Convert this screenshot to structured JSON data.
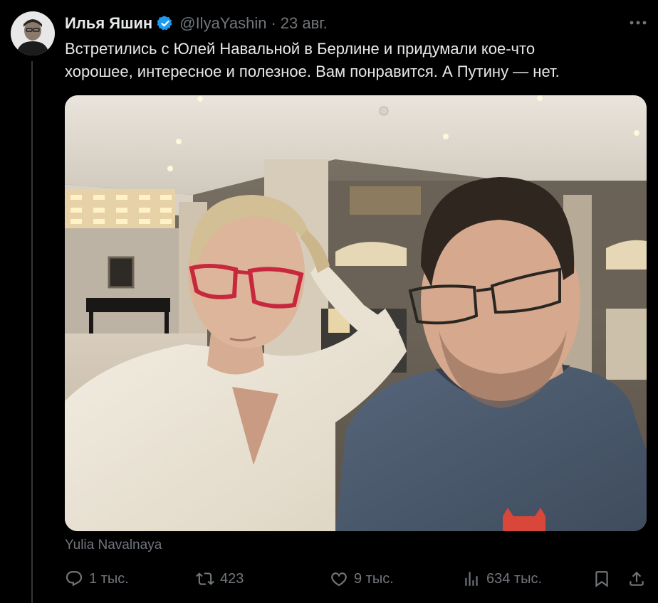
{
  "tweet": {
    "author": {
      "display_name": "Илья Яшин",
      "handle": "@IlyaYashin",
      "verified_icon": "verified-badge-icon"
    },
    "separator": "·",
    "time": "23 авг.",
    "text": "Встретились с Юлей Навальной в Берлине и придумали кое-что\nхорошее, интересное и полезное. Вам понравится. А Путину — нет.",
    "media": {
      "type": "photo",
      "tagged_user": "Yulia Navalnaya"
    },
    "actions": {
      "reply_count": "1 тыс.",
      "retweet_count": "423",
      "like_count": "9 тыс.",
      "views_count": "634 тыс."
    }
  },
  "icons": {
    "more": "more-horizontal-icon",
    "reply": "reply-icon",
    "retweet": "retweet-icon",
    "like": "heart-icon",
    "views": "views-chart-icon",
    "bookmark": "bookmark-icon",
    "share": "share-icon"
  },
  "colors": {
    "background": "#000000",
    "text_primary": "#e7e9ea",
    "text_secondary": "#71767b",
    "verified_blue": "#1d9bf0",
    "thread_line": "#333639"
  }
}
